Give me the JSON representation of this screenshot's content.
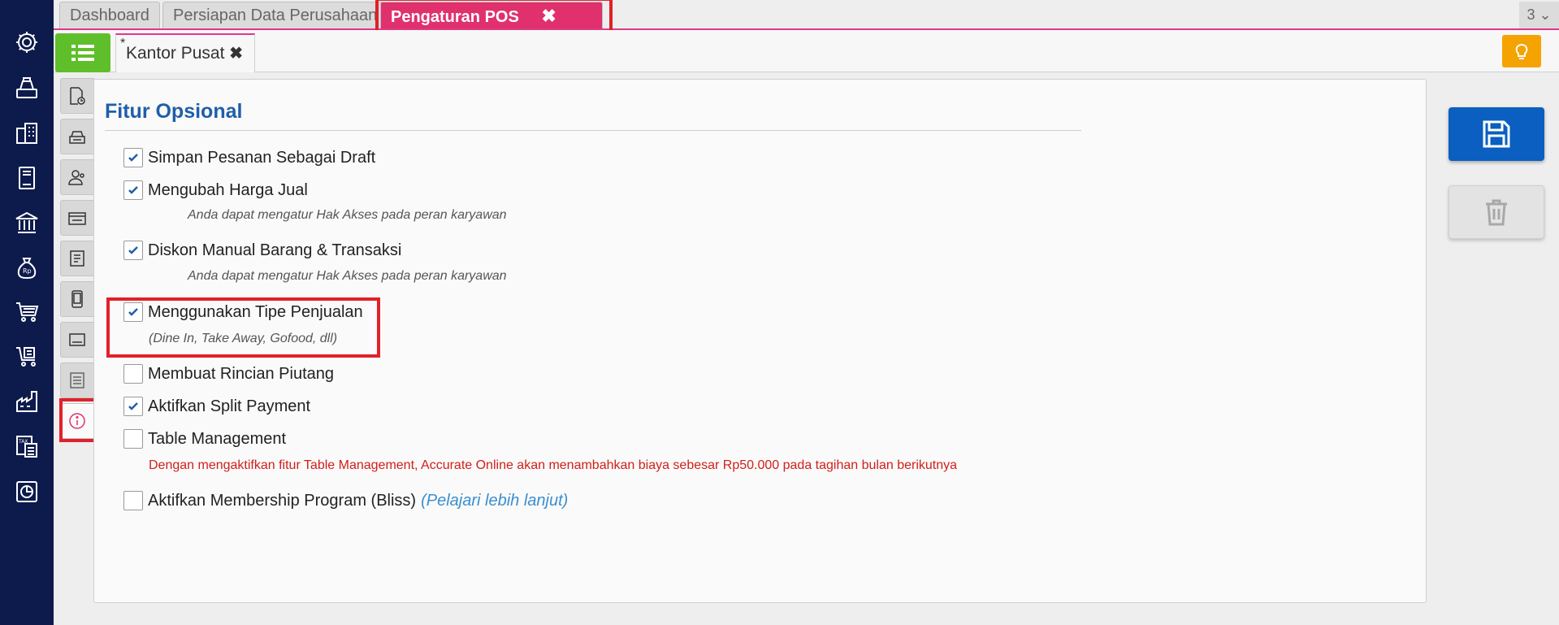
{
  "top_tabs": [
    {
      "label": "Dashboard"
    },
    {
      "label": "Persiapan Data Perusahaan"
    },
    {
      "label": "Pengaturan POS",
      "close": "✖"
    }
  ],
  "tab_count": "3 ⌄",
  "sub_tab": {
    "star": "*",
    "label": "Kantor Pusat",
    "close": "✖"
  },
  "section": {
    "title": "Fitur Opsional"
  },
  "options": [
    {
      "label": "Simpan Pesanan Sebagai Draft",
      "checked": true
    },
    {
      "label": "Mengubah Harga Jual",
      "checked": true,
      "hint": "Anda dapat mengatur Hak Akses pada peran karyawan"
    },
    {
      "label": "Diskon Manual Barang & Transaksi",
      "checked": true,
      "hint": "Anda dapat mengatur Hak Akses pada peran karyawan"
    },
    {
      "label": "Menggunakan Tipe Penjualan",
      "checked": true,
      "hint": "(Dine In, Take Away, Gofood, dll)"
    },
    {
      "label": "Membuat Rincian Piutang",
      "checked": false
    },
    {
      "label": "Aktifkan Split Payment",
      "checked": true
    },
    {
      "label": "Table Management",
      "checked": false,
      "warning": "Dengan mengaktifkan fitur Table Management, Accurate Online akan menambahkan biaya sebesar Rp50.000 pada tagihan bulan berikutnya"
    },
    {
      "label": "Aktifkan Membership Program (Bliss)",
      "checked": false,
      "link": "(Pelajari lebih lanjut)"
    }
  ],
  "left_nav_icons": [
    "gear-icon",
    "cashier-icon",
    "building-icon",
    "book-icon",
    "bank-icon",
    "money-bag-icon",
    "cart-icon",
    "delivery-cart-icon",
    "factory-icon",
    "tax-icon",
    "report-icon"
  ],
  "side_tabs": [
    "document-clock-icon",
    "printer-icon",
    "users-icon",
    "card-icon",
    "receipt-icon",
    "tablet-icon",
    "price-tag-icon",
    "list-icon",
    "info-icon"
  ],
  "colors": {
    "nav": "#0d1b4c",
    "accent": "#e0306e",
    "title": "#1f5fa8",
    "save": "#0a5fc0",
    "highlight": "#e0212a"
  }
}
